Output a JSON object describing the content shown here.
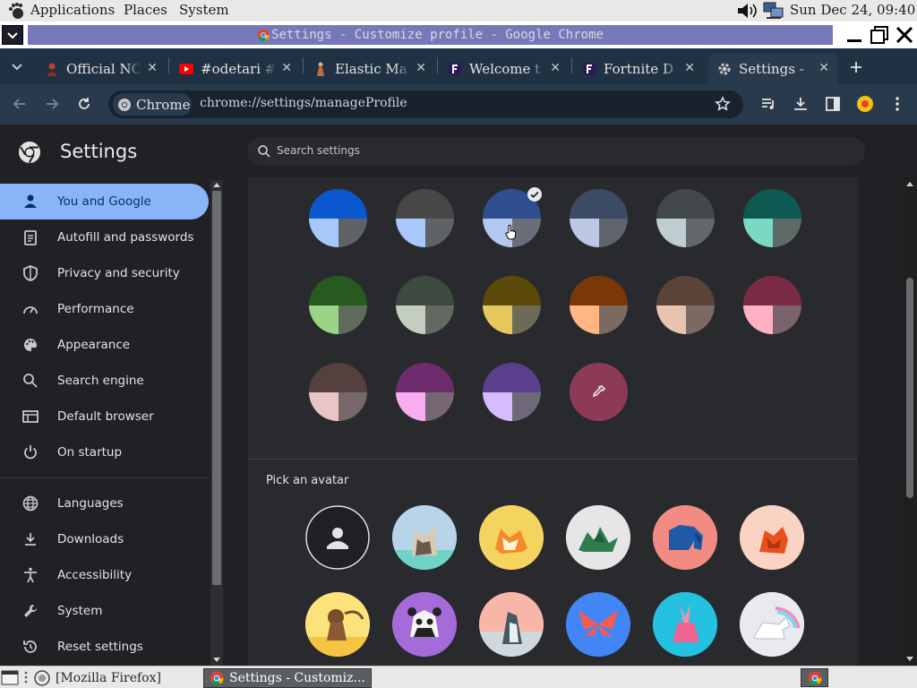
{
  "panel": {
    "menus": [
      "Applications",
      "Places",
      "System"
    ],
    "clock": "Sun Dec 24, 09:40"
  },
  "window": {
    "title": "Settings - Customize profile - Google Chrome"
  },
  "tabs": [
    {
      "label": "Official NC",
      "icon": "nc-profile-icon",
      "active": false
    },
    {
      "label": "#odetari #",
      "icon": "youtube-icon",
      "active": false
    },
    {
      "label": "Elastic Ma",
      "icon": "elastic-person-icon",
      "active": false
    },
    {
      "label": "Welcome t",
      "icon": "fortnite-icon",
      "active": false
    },
    {
      "label": "Fortnite D",
      "icon": "fortnite-icon",
      "active": false
    },
    {
      "label": "Settings - ",
      "icon": "gear-icon",
      "active": true
    }
  ],
  "toolbar": {
    "chip_label": "Chrome",
    "url": "chrome://settings/manageProfile"
  },
  "settings": {
    "title": "Settings",
    "search_placeholder": "Search settings",
    "nav": [
      {
        "label": "You and Google",
        "icon": "person-icon",
        "active": true
      },
      {
        "label": "Autofill and passwords",
        "icon": "clipboard-icon"
      },
      {
        "label": "Privacy and security",
        "icon": "shield-icon"
      },
      {
        "label": "Performance",
        "icon": "speedometer-icon"
      },
      {
        "label": "Appearance",
        "icon": "palette-icon"
      },
      {
        "label": "Search engine",
        "icon": "search-icon"
      },
      {
        "label": "Default browser",
        "icon": "browser-window-icon"
      },
      {
        "label": "On startup",
        "icon": "power-icon"
      },
      {
        "label": "Languages",
        "icon": "globe-icon"
      },
      {
        "label": "Downloads",
        "icon": "download-icon"
      },
      {
        "label": "Accessibility",
        "icon": "accessibility-icon"
      },
      {
        "label": "System",
        "icon": "wrench-icon"
      },
      {
        "label": "Reset settings",
        "icon": "history-icon"
      }
    ],
    "theme_colors": [
      {
        "top": "#0b57d0",
        "left": "#a8c7fa",
        "right": "#5f6368",
        "selected": false
      },
      {
        "top": "#474747",
        "left": "#a8c7fa",
        "right": "#5f6368",
        "selected": false
      },
      {
        "top": "#2f4f8f",
        "left": "#b3c8f0",
        "right": "#6a6e78",
        "selected": true
      },
      {
        "top": "#3c4a63",
        "left": "#bcc8e4",
        "right": "#60646e",
        "selected": false
      },
      {
        "top": "#43494b",
        "left": "#c0cdd0",
        "right": "#62676a",
        "selected": false
      },
      {
        "top": "#0e5a52",
        "left": "#79d9c5",
        "right": "#5d6b68",
        "selected": false
      },
      {
        "top": "#265a1f",
        "left": "#99d487",
        "right": "#5e6b5b",
        "selected": false
      },
      {
        "top": "#3d4a40",
        "left": "#c3cdc0",
        "right": "#636862",
        "selected": false
      },
      {
        "top": "#5c4a0a",
        "left": "#e6c85e",
        "right": "#6e6a58",
        "selected": false
      },
      {
        "top": "#7a3808",
        "left": "#ffb683",
        "right": "#7b6a60",
        "selected": false
      },
      {
        "top": "#5a4439",
        "left": "#e8c3af",
        "right": "#7a6a63",
        "selected": false
      },
      {
        "top": "#7b2a45",
        "left": "#ffb1c3",
        "right": "#7a636a",
        "selected": false
      },
      {
        "top": "#553f3f",
        "left": "#e9c6c6",
        "right": "#76686a",
        "selected": false
      },
      {
        "top": "#6e2c6e",
        "left": "#f7adef",
        "right": "#76666f",
        "selected": false
      },
      {
        "top": "#5a3f8c",
        "left": "#d7bbff",
        "right": "#6e6877",
        "selected": false
      }
    ],
    "custom_color": "#8c3a55",
    "avatar_section_title": "Pick an avatar",
    "avatars": [
      {
        "name": "generic-person-avatar",
        "bg": "#202124"
      },
      {
        "name": "origami-cat-avatar",
        "bg": "#b8d4e8"
      },
      {
        "name": "origami-fox-avatar",
        "bg": "#f4d35e"
      },
      {
        "name": "origami-dragon-avatar",
        "bg": "#e6e6e6"
      },
      {
        "name": "origami-elephant-avatar",
        "bg": "#f28b82"
      },
      {
        "name": "origami-red-fox-avatar",
        "bg": "#fbd3c4"
      },
      {
        "name": "origami-monkey-avatar",
        "bg": "#fbe27a"
      },
      {
        "name": "origami-panda-avatar",
        "bg": "#a56bd8"
      },
      {
        "name": "origami-penguin-avatar",
        "bg": "#f7b6a8"
      },
      {
        "name": "origami-butterfly-avatar",
        "bg": "#4285f4"
      },
      {
        "name": "origami-rabbit-avatar",
        "bg": "#24c1e0"
      },
      {
        "name": "origami-unicorn-avatar",
        "bg": "#e8eaed"
      }
    ]
  },
  "taskbar": {
    "items": [
      {
        "label": "[Mozilla Firefox]",
        "active": false
      },
      {
        "label": "Settings - Customiz...",
        "active": true
      }
    ]
  }
}
